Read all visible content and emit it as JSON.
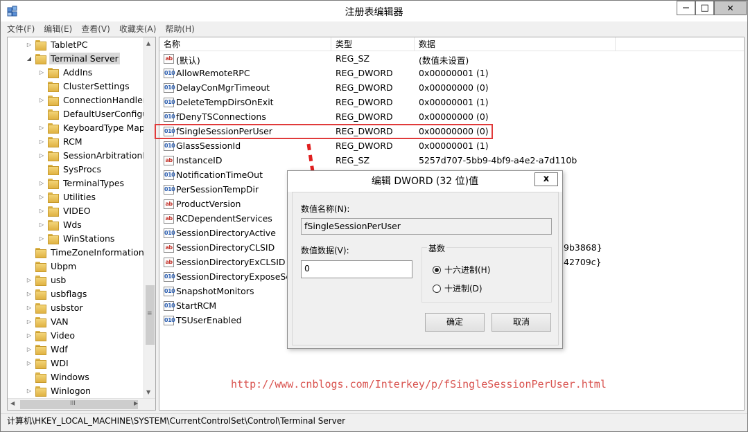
{
  "window": {
    "title": "注册表编辑器",
    "controls": {
      "minimize": "—",
      "maximize": "□",
      "close": "✕"
    }
  },
  "menu": [
    "文件(F)",
    "编辑(E)",
    "查看(V)",
    "收藏夹(A)",
    "帮助(H)"
  ],
  "tree": {
    "items": [
      {
        "label": "TabletPC",
        "expander": "▷"
      },
      {
        "label": "Terminal Server",
        "expander": "◢",
        "selected": true
      },
      {
        "label": "AddIns",
        "expander": "▷"
      },
      {
        "label": "ClusterSettings",
        "expander": ""
      },
      {
        "label": "ConnectionHandler",
        "expander": "▷"
      },
      {
        "label": "DefaultUserConfigu",
        "expander": ""
      },
      {
        "label": "KeyboardType Map",
        "expander": "▷"
      },
      {
        "label": "RCM",
        "expander": "▷"
      },
      {
        "label": "SessionArbitrationH",
        "expander": "▷"
      },
      {
        "label": "SysProcs",
        "expander": ""
      },
      {
        "label": "TerminalTypes",
        "expander": "▷"
      },
      {
        "label": "Utilities",
        "expander": "▷"
      },
      {
        "label": "VIDEO",
        "expander": "▷"
      },
      {
        "label": "Wds",
        "expander": "▷"
      },
      {
        "label": "WinStations",
        "expander": "▷"
      },
      {
        "label": "TimeZoneInformation",
        "expander": ""
      },
      {
        "label": "Ubpm",
        "expander": ""
      },
      {
        "label": "usb",
        "expander": "▷"
      },
      {
        "label": "usbflags",
        "expander": "▷"
      },
      {
        "label": "usbstor",
        "expander": "▷"
      },
      {
        "label": "VAN",
        "expander": "▷"
      },
      {
        "label": "Video",
        "expander": "▷"
      },
      {
        "label": "Wdf",
        "expander": "▷"
      },
      {
        "label": "WDI",
        "expander": "▷"
      },
      {
        "label": "Windows",
        "expander": ""
      },
      {
        "label": "Winlogon",
        "expander": "▷"
      }
    ],
    "scroll_grip": "≡",
    "hscroll_grip": "III"
  },
  "list": {
    "columns": [
      "名称",
      "类型",
      "数据"
    ],
    "rows": [
      {
        "icon": "ab",
        "kind": "sz",
        "name": "(默认)",
        "type": "REG_SZ",
        "data": "(数值未设置)"
      },
      {
        "icon": "010",
        "kind": "dw",
        "name": "AllowRemoteRPC",
        "type": "REG_DWORD",
        "data": "0x00000001 (1)"
      },
      {
        "icon": "010",
        "kind": "dw",
        "name": "DelayConMgrTimeout",
        "type": "REG_DWORD",
        "data": "0x00000000 (0)"
      },
      {
        "icon": "010",
        "kind": "dw",
        "name": "DeleteTempDirsOnExit",
        "type": "REG_DWORD",
        "data": "0x00000001 (1)"
      },
      {
        "icon": "010",
        "kind": "dw",
        "name": "fDenyTSConnections",
        "type": "REG_DWORD",
        "data": "0x00000000 (0)"
      },
      {
        "icon": "010",
        "kind": "dw",
        "name": "fSingleSessionPerUser",
        "type": "REG_DWORD",
        "data": "0x00000000 (0)"
      },
      {
        "icon": "010",
        "kind": "dw",
        "name": "GlassSessionId",
        "type": "REG_DWORD",
        "data": "0x00000001 (1)"
      },
      {
        "icon": "ab",
        "kind": "sz",
        "name": "InstanceID",
        "type": "REG_SZ",
        "data": "5257d707-5bb9-4bf9-a4e2-a7d110b"
      },
      {
        "icon": "010",
        "kind": "dw",
        "name": "NotificationTimeOut",
        "type": "",
        "data": ""
      },
      {
        "icon": "010",
        "kind": "dw",
        "name": "PerSessionTempDir",
        "type": "",
        "data": ""
      },
      {
        "icon": "ab",
        "kind": "sz",
        "name": "ProductVersion",
        "type": "",
        "data": ""
      },
      {
        "icon": "ab",
        "kind": "sz",
        "name": "RCDependentServices",
        "type": "",
        "data": ""
      },
      {
        "icon": "010",
        "kind": "dw",
        "name": "SessionDirectoryActive",
        "type": "",
        "data": ""
      },
      {
        "icon": "ab",
        "kind": "sz",
        "name": "SessionDirectoryCLSID",
        "type": "",
        "data": "9b3868}"
      },
      {
        "icon": "ab",
        "kind": "sz",
        "name": "SessionDirectoryExCLSID",
        "type": "",
        "data": "42709c}"
      },
      {
        "icon": "010",
        "kind": "dw",
        "name": "SessionDirectoryExposeServ",
        "type": "",
        "data": ""
      },
      {
        "icon": "010",
        "kind": "dw",
        "name": "SnapshotMonitors",
        "type": "",
        "data": ""
      },
      {
        "icon": "010",
        "kind": "dw",
        "name": "StartRCM",
        "type": "",
        "data": ""
      },
      {
        "icon": "010",
        "kind": "dw",
        "name": "TSUserEnabled",
        "type": "",
        "data": ""
      }
    ]
  },
  "dialog": {
    "title": "编辑 DWORD (32 位)值",
    "close": "x",
    "name_label": "数值名称(N):",
    "name_value": "fSingleSessionPerUser",
    "data_label": "数值数据(V):",
    "data_value": "0",
    "base_label": "基数",
    "radio_hex": "十六进制(H)",
    "radio_dec": "十进制(D)",
    "base_selected": "hex",
    "ok": "确定",
    "cancel": "取消"
  },
  "watermark": "http://www.cnblogs.com/Interkey/p/fSingleSessionPerUser.html",
  "status_path": "计算机\\HKEY_LOCAL_MACHINE\\SYSTEM\\CurrentControlSet\\Control\\Terminal Server",
  "colors": {
    "highlight": "#e03a3a",
    "watermark": "#d9534f",
    "selected_tree": "#d9d9d9"
  }
}
